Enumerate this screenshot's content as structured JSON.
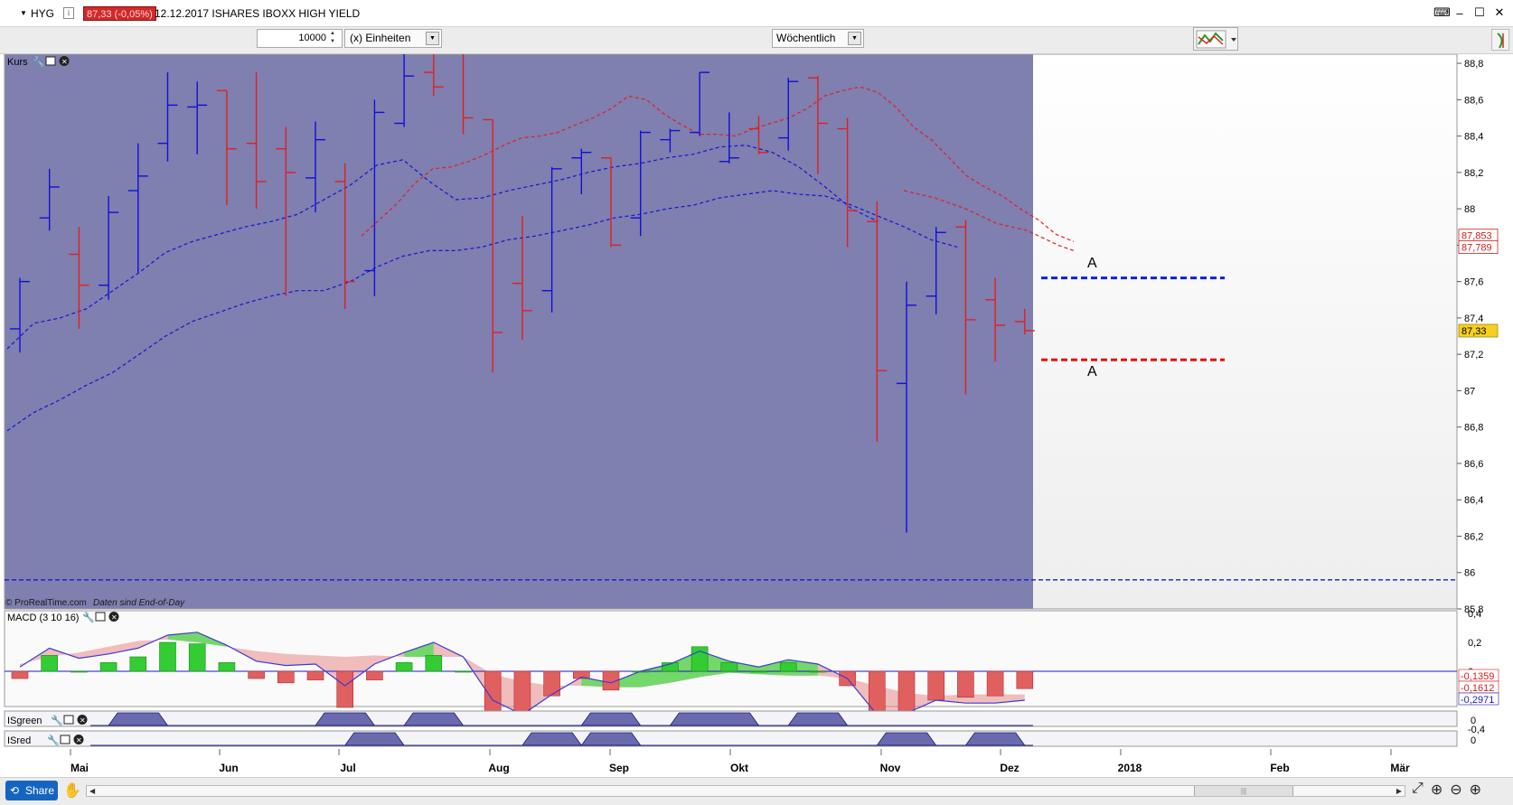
{
  "header": {
    "symbol": "HYG",
    "info_label": "i",
    "price": "87,33 (-0,05%)",
    "description": "12.12.2017 ISHARES IBOXX  HIGH YIELD",
    "icons": [
      "keyboard-icon",
      "minimize-icon",
      "maximize-icon",
      "close-icon"
    ]
  },
  "toolbar": {
    "quantity": "10000",
    "unit": "(x) Einheiten",
    "period": "Wöchentlich"
  },
  "panels": {
    "price_panel": "Kurs",
    "macd_panel": "MACD (3 10 16)",
    "isgreen_panel": "ISgreen",
    "isred_panel": "ISred",
    "isgreen_value": "0",
    "isred_value": "0"
  },
  "watermark": {
    "source": "© ProRealTime.com",
    "note": "Daten sind End-of-Day"
  },
  "annotations": {
    "upper_label": "A",
    "lower_label": "A"
  },
  "colors": {
    "background_shade": "#7f7fb0",
    "bull_bar": "#1010d8",
    "bear_bar": "#e02020",
    "macd_pos": "#33cc33",
    "macd_neg": "#e06060",
    "price_badge": "#f5d020"
  },
  "chart_data": {
    "type": "ohlc",
    "y_ticks": [
      "88,8",
      "88,6",
      "88,4",
      "88,2",
      "88",
      "87,8",
      "87,6",
      "87,4",
      "87,2",
      "87",
      "86,8",
      "86,6",
      "86,4",
      "86,2",
      "86",
      "85,8"
    ],
    "ylim": [
      85.8,
      88.85
    ],
    "x_ticks": [
      "Mai",
      "Jun",
      "Jul",
      "Aug",
      "Sep",
      "Okt",
      "Nov",
      "Dez",
      "2018",
      "Feb",
      "Mär"
    ],
    "weekly_bars": [
      {
        "o": 87.34,
        "h": 87.62,
        "l": 87.21,
        "c": 87.6
      },
      {
        "o": 87.95,
        "h": 88.22,
        "l": 87.88,
        "c": 88.12
      },
      {
        "o": 87.75,
        "h": 87.9,
        "l": 87.34,
        "c": 87.58
      },
      {
        "o": 87.58,
        "h": 88.07,
        "l": 87.5,
        "c": 87.98
      },
      {
        "o": 88.1,
        "h": 88.36,
        "l": 87.65,
        "c": 88.18
      },
      {
        "o": 88.36,
        "h": 88.75,
        "l": 88.26,
        "c": 88.57
      },
      {
        "o": 88.56,
        "h": 88.7,
        "l": 88.3,
        "c": 88.57
      },
      {
        "o": 88.65,
        "h": 88.65,
        "l": 88.02,
        "c": 88.33
      },
      {
        "o": 88.36,
        "h": 88.75,
        "l": 88,
        "c": 88.15
      },
      {
        "o": 88.33,
        "h": 88.45,
        "l": 87.52,
        "c": 88.2
      },
      {
        "o": 88.17,
        "h": 88.48,
        "l": 87.98,
        "c": 88.38
      },
      {
        "o": 88.15,
        "h": 88.25,
        "l": 87.45,
        "c": 87.6
      },
      {
        "o": 87.66,
        "h": 88.6,
        "l": 87.52,
        "c": 88.53
      },
      {
        "o": 88.47,
        "h": 88.92,
        "l": 88.45,
        "c": 88.73
      },
      {
        "o": 88.75,
        "h": 88.85,
        "l": 88.62,
        "c": 88.67
      },
      {
        "o": 88.88,
        "h": 88.88,
        "l": 88.41,
        "c": 88.5
      },
      {
        "o": 88.49,
        "h": 88.49,
        "l": 87.1,
        "c": 87.32
      },
      {
        "o": 87.59,
        "h": 87.96,
        "l": 87.28,
        "c": 87.44
      },
      {
        "o": 87.55,
        "h": 88.23,
        "l": 87.43,
        "c": 88.22
      },
      {
        "o": 88.28,
        "h": 88.33,
        "l": 88.08,
        "c": 88.31
      },
      {
        "o": 88.28,
        "h": 88.28,
        "l": 87.79,
        "c": 87.8
      },
      {
        "o": 87.95,
        "h": 88.43,
        "l": 87.85,
        "c": 88.42
      },
      {
        "o": 88.38,
        "h": 88.44,
        "l": 88.31,
        "c": 88.43
      },
      {
        "o": 88.42,
        "h": 88.75,
        "l": 88.4,
        "c": 88.75
      },
      {
        "o": 88.26,
        "h": 88.53,
        "l": 88.25,
        "c": 88.28
      },
      {
        "o": 88.44,
        "h": 88.51,
        "l": 88.3,
        "c": 88.31
      },
      {
        "o": 88.39,
        "h": 88.72,
        "l": 88.32,
        "c": 88.7
      },
      {
        "o": 88.72,
        "h": 88.73,
        "l": 88.19,
        "c": 88.47
      },
      {
        "o": 88.44,
        "h": 88.5,
        "l": 87.79,
        "c": 87.99
      },
      {
        "o": 87.93,
        "h": 88.04,
        "l": 86.72,
        "c": 87.11
      },
      {
        "o": 87.04,
        "h": 87.6,
        "l": 86.22,
        "c": 87.47
      },
      {
        "o": 87.52,
        "h": 87.9,
        "l": 87.42,
        "c": 87.87
      },
      {
        "o": 87.9,
        "h": 87.94,
        "l": 86.98,
        "c": 87.39
      },
      {
        "o": 87.5,
        "h": 87.62,
        "l": 87.16,
        "c": 87.36
      },
      {
        "o": 87.38,
        "h": 87.45,
        "l": 87.31,
        "c": 87.33
      }
    ],
    "series_ma_fast_red": [
      87.85,
      87.94,
      88.03,
      88.14,
      88.22,
      88.23,
      88.26,
      88.3,
      88.35,
      88.39,
      88.4,
      88.42,
      88.46,
      88.5,
      88.55,
      88.62,
      88.6,
      88.52,
      88.46,
      88.41,
      88.41,
      88.4,
      88.44,
      88.47,
      88.5,
      88.55,
      88.62,
      88.65,
      88.67,
      88.64,
      88.56,
      88.45,
      88.38,
      88.28,
      88.18,
      88.12,
      88.07,
      88,
      87.94,
      87.86,
      87.82
    ],
    "series_ma_fast_blue": [
      87.23,
      87.37,
      87.4,
      87.45,
      87.55,
      87.65,
      87.76,
      87.82,
      87.86,
      87.9,
      87.93,
      87.97,
      88.05,
      88.13,
      88.24,
      88.27,
      88.15,
      88.05,
      88.06,
      88.1,
      88.13,
      88.16,
      88.2,
      88.23,
      88.25,
      88.28,
      88.3,
      88.34,
      88.35,
      88.31,
      88.23,
      88.12,
      88,
      87.93
    ],
    "series_ma_slow_blue": [
      86.78,
      86.88,
      86.95,
      87.03,
      87.1,
      87.2,
      87.3,
      87.38,
      87.43,
      87.48,
      87.52,
      87.55,
      87.55,
      87.6,
      87.68,
      87.74,
      87.77,
      87.77,
      87.79,
      87.83,
      87.85,
      87.88,
      87.91,
      87.95,
      87.97,
      88,
      88.02,
      88.06,
      88.08,
      88.1,
      88.08,
      88.07,
      88.02,
      87.96,
      87.9,
      87.83,
      87.79
    ],
    "series_ma_slow_red": [
      87.55,
      87.52,
      87.5,
      87.42,
      87.32,
      87.2,
      87.08,
      86.98,
      86.92,
      86.87,
      86.84,
      86.82,
      86.8,
      86.78,
      86.78,
      86.78,
      86.77,
      86.79,
      86.8
    ],
    "price_labels": [
      {
        "text": "87,853",
        "value": 87.853,
        "color": "#d21c1c"
      },
      {
        "text": "87,789",
        "value": 87.789,
        "color": "#d21c1c"
      },
      {
        "text": "87,33",
        "value": 87.33,
        "color": "#000"
      }
    ],
    "levels": [
      {
        "value": 87.62,
        "color": "#0a22d8",
        "label": "A"
      },
      {
        "value": 87.17,
        "color": "#e50f0f",
        "label": "A"
      },
      {
        "value": 85.96,
        "color": "#1a1acc"
      }
    ],
    "macd_histogram": [
      -0.05,
      0.11,
      0,
      0.06,
      0.1,
      0.2,
      0.19,
      0.06,
      -0.05,
      -0.08,
      -0.06,
      -0.25,
      -0.06,
      0.06,
      0.11,
      0,
      -0.33,
      -0.37,
      -0.17,
      -0.05,
      -0.13,
      0,
      0.06,
      0.17,
      0.06,
      0,
      0.06,
      0,
      -0.1,
      -0.36,
      -0.33,
      -0.2,
      -0.18,
      -0.17,
      -0.12
    ],
    "macd_signal": [
      0.05,
      0.1,
      0.13,
      0.17,
      0.21,
      0.22,
      0.2,
      0.17,
      0.14,
      0.12,
      0.11,
      0.1,
      0.11,
      0.1,
      0.1,
      0.1,
      -0.02,
      -0.07,
      -0.1,
      -0.1,
      -0.11,
      -0.11,
      -0.08,
      -0.04,
      -0.01,
      -0.02,
      -0.03,
      -0.03,
      -0.05,
      -0.1,
      -0.15,
      -0.17,
      -0.16,
      -0.16,
      -0.16
    ],
    "macd_line": [
      0.03,
      0.16,
      0.09,
      0.12,
      0.16,
      0.25,
      0.27,
      0.18,
      0.07,
      0.04,
      0.05,
      -0.1,
      0.05,
      0.13,
      0.2,
      0.1,
      -0.2,
      -0.3,
      -0.16,
      -0.04,
      -0.08,
      0,
      0.05,
      0.14,
      0.07,
      0.03,
      0.08,
      0.05,
      -0.05,
      -0.3,
      -0.29,
      -0.2,
      -0.22,
      -0.22,
      -0.2
    ],
    "macd_ticks": [
      "0,4",
      "0,2",
      "0",
      "-0,4"
    ],
    "macd_labels": [
      {
        "text": "-0,1359",
        "color": "#d21c1c"
      },
      {
        "text": "-0,1612",
        "color": "#d21c1c"
      },
      {
        "text": "-0,2971",
        "color": "#1a1acc"
      }
    ],
    "isgreen_peaks": [
      [
        3,
        5
      ],
      [
        10,
        12
      ],
      [
        13,
        15
      ],
      [
        19,
        21
      ],
      [
        22,
        25
      ],
      [
        26,
        28
      ]
    ],
    "isred_peaks": [
      [
        11,
        13
      ],
      [
        17,
        19
      ],
      [
        19,
        21
      ],
      [
        29,
        31
      ],
      [
        32,
        34
      ]
    ]
  }
}
